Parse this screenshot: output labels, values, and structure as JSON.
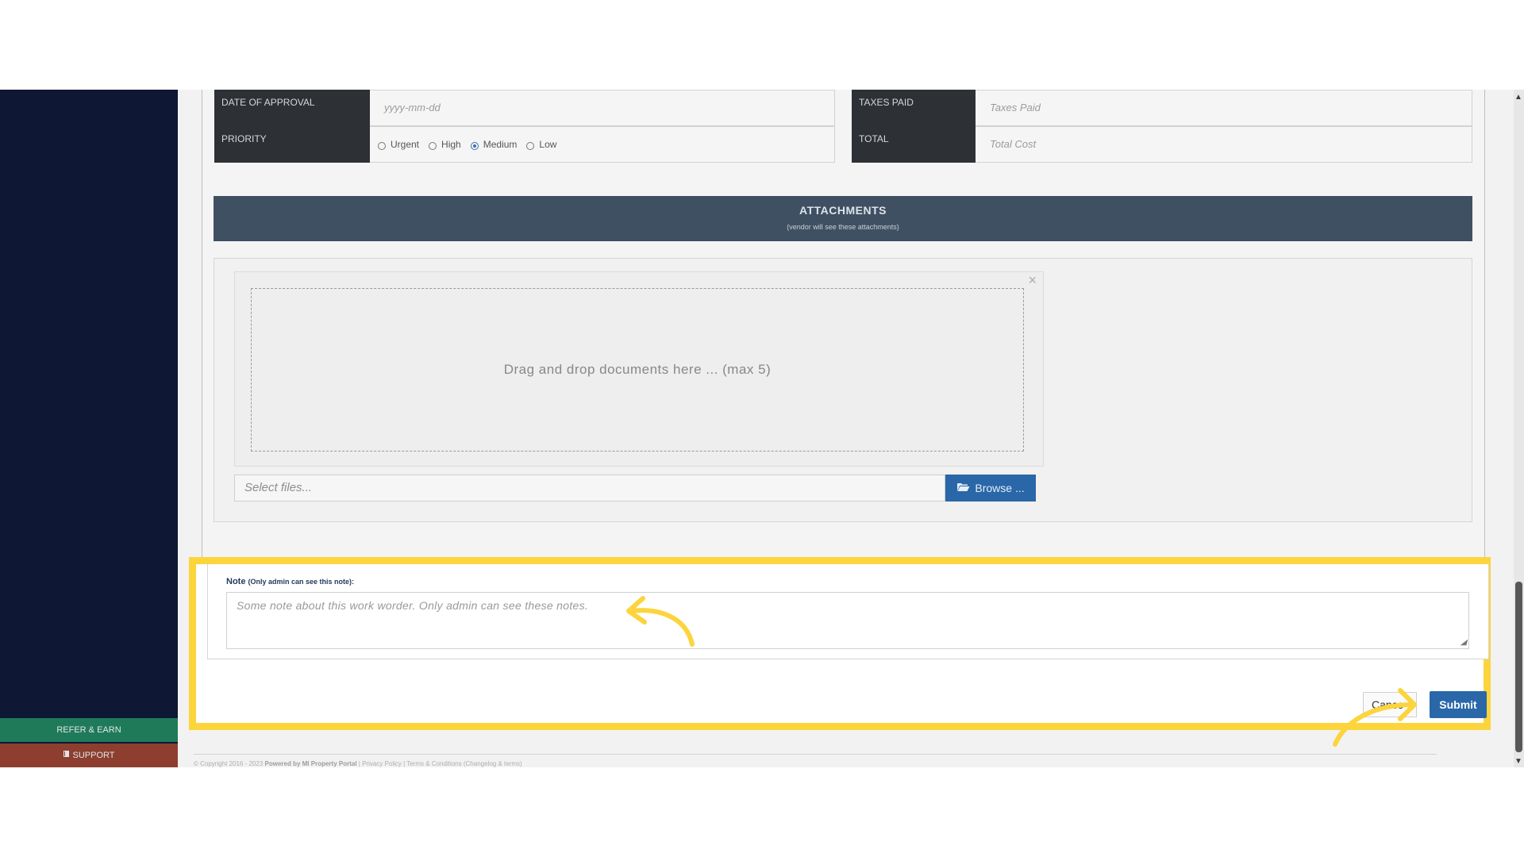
{
  "form": {
    "date_of_approval": {
      "label": "DATE OF APPROVAL",
      "placeholder": "yyyy-mm-dd"
    },
    "taxes_paid": {
      "label": "TAXES PAID",
      "placeholder": "Taxes Paid"
    },
    "priority": {
      "label": "PRIORITY",
      "options": [
        "Urgent",
        "High",
        "Medium",
        "Low"
      ],
      "selected": "Medium"
    },
    "total": {
      "label": "TOTAL",
      "placeholder": "Total Cost"
    }
  },
  "attachments": {
    "title": "ATTACHMENTS",
    "subtitle": "(vendor will see these attachments)",
    "dropzone_text": "Drag and drop documents here ... (max 5)",
    "file_placeholder": "Select files...",
    "browse_label": "Browse ..."
  },
  "note": {
    "label": "Note",
    "label_hint": "(Only admin can see this note):",
    "placeholder": "Some note about this work worder. Only admin can see these notes."
  },
  "actions": {
    "cancel_label": "Cance",
    "submit_label": "Submit"
  },
  "sidebar": {
    "refer_label": "REFER & EARN",
    "support_label": "SUPPORT"
  },
  "footer": {
    "copyright": "© Copyright 2016 - 2023",
    "powered": "Powered by MI Property Portal",
    "privacy": "Privacy Policy",
    "terms": "Terms & Conditions",
    "extra": "(Changelog & terms)"
  },
  "colors": {
    "sidebar_bg": "#0e1834",
    "primary_button": "#2a67a8",
    "label_bg": "#2d3136",
    "attachments_header": "#3f5063",
    "highlight": "#fcd43c",
    "refer_bg": "#1f7a5a",
    "support_bg": "#8e3e2f"
  },
  "icons": {
    "browse": "folder-open-icon",
    "support": "book-icon",
    "close": "close-icon",
    "scroll_up": "triangle-up-icon",
    "scroll_down": "triangle-down-icon"
  }
}
